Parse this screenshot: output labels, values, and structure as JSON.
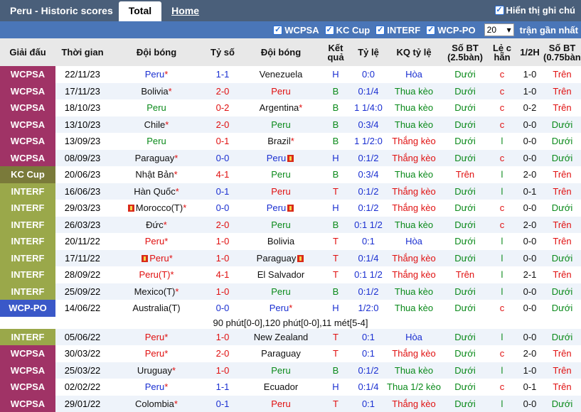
{
  "header": {
    "title": "Peru - Historic scores",
    "tab_total": "Total",
    "tab_home": "Home",
    "show_handicap_label": "Hiển thị ghi chú"
  },
  "filters": {
    "items": [
      "WCPSA",
      "KC Cup",
      "INTERF",
      "WCP-PO"
    ],
    "count_value": "20",
    "count_suffix": "trận gần nhất"
  },
  "columns": [
    "Giải đấu",
    "Thời gian",
    "Đội bóng",
    "Tỷ số",
    "Đội bóng",
    "Kết quả",
    "Tỷ lệ",
    "KQ tỷ lệ",
    "Số BT (2.5bàn)",
    "Lẻ c hẵn",
    "1/2H",
    "Số BT (0.75bàn)"
  ],
  "colors": {
    "WCPSA": "#a03366",
    "KC Cup": "#7a7a3a",
    "INTERF": "#9aa84a",
    "WCP-PO": "#3a58c8"
  },
  "separator_note": "90 phút[0-0],120 phút[0-0],11 mét[5-4]",
  "rows": [
    {
      "league": "WCPSA",
      "date": "22/11/23",
      "home": "Peru",
      "home_star": true,
      "home_flag": false,
      "home_color": "blue",
      "score": "1-1",
      "score_color": "blue",
      "away": "Venezuela",
      "away_star": false,
      "away_flag": false,
      "away_color": "black",
      "result": "H",
      "odds": "0:0",
      "odds_result": "Hòa",
      "ou": "Dưới",
      "oe": "c",
      "ht": "1-0",
      "ou2": "Trên"
    },
    {
      "league": "WCPSA",
      "date": "17/11/23",
      "home": "Bolivia",
      "home_star": true,
      "home_flag": false,
      "home_color": "black",
      "score": "2-0",
      "score_color": "red",
      "away": "Peru",
      "away_star": false,
      "away_flag": false,
      "away_color": "red",
      "result": "B",
      "odds": "0:1/4",
      "odds_result": "Thua kèo",
      "ou": "Dưới",
      "oe": "c",
      "ht": "1-0",
      "ou2": "Trên"
    },
    {
      "league": "WCPSA",
      "date": "18/10/23",
      "home": "Peru",
      "home_star": false,
      "home_flag": false,
      "home_color": "green",
      "score": "0-2",
      "score_color": "red",
      "away": "Argentina",
      "away_star": true,
      "away_flag": false,
      "away_color": "black",
      "result": "B",
      "odds": "1 1/4:0",
      "odds_result": "Thua kèo",
      "ou": "Dưới",
      "oe": "c",
      "ht": "0-2",
      "ou2": "Trên"
    },
    {
      "league": "WCPSA",
      "date": "13/10/23",
      "home": "Chile",
      "home_star": true,
      "home_flag": false,
      "home_color": "black",
      "score": "2-0",
      "score_color": "red",
      "away": "Peru",
      "away_star": false,
      "away_flag": false,
      "away_color": "green",
      "result": "B",
      "odds": "0:3/4",
      "odds_result": "Thua kèo",
      "ou": "Dưới",
      "oe": "c",
      "ht": "0-0",
      "ou2": "Dưới"
    },
    {
      "league": "WCPSA",
      "date": "13/09/23",
      "home": "Peru",
      "home_star": false,
      "home_flag": false,
      "home_color": "green",
      "score": "0-1",
      "score_color": "red",
      "away": "Brazil",
      "away_star": true,
      "away_flag": false,
      "away_color": "black",
      "result": "B",
      "odds": "1 1/2:0",
      "odds_result": "Thắng kèo",
      "ou": "Dưới",
      "oe": "l",
      "ht": "0-0",
      "ou2": "Dưới"
    },
    {
      "league": "WCPSA",
      "date": "08/09/23",
      "home": "Paraguay",
      "home_star": true,
      "home_flag": false,
      "home_color": "black",
      "score": "0-0",
      "score_color": "blue",
      "away": "Peru",
      "away_star": false,
      "away_flag": true,
      "away_color": "blue",
      "result": "H",
      "odds": "0:1/2",
      "odds_result": "Thắng kèo",
      "ou": "Dưới",
      "oe": "c",
      "ht": "0-0",
      "ou2": "Dưới"
    },
    {
      "league": "KC Cup",
      "date": "20/06/23",
      "home": "Nhật Bản",
      "home_star": true,
      "home_flag": false,
      "home_color": "black",
      "score": "4-1",
      "score_color": "red",
      "away": "Peru",
      "away_star": false,
      "away_flag": false,
      "away_color": "green",
      "result": "B",
      "odds": "0:3/4",
      "odds_result": "Thua kèo",
      "ou": "Trên",
      "oe": "l",
      "ht": "2-0",
      "ou2": "Trên"
    },
    {
      "league": "INTERF",
      "date": "16/06/23",
      "home": "Hàn Quốc",
      "home_star": true,
      "home_flag": false,
      "home_color": "black",
      "score": "0-1",
      "score_color": "blue",
      "away": "Peru",
      "away_star": false,
      "away_flag": false,
      "away_color": "red",
      "result": "T",
      "odds": "0:1/2",
      "odds_result": "Thắng kèo",
      "ou": "Dưới",
      "oe": "l",
      "ht": "0-1",
      "ou2": "Trên"
    },
    {
      "league": "INTERF",
      "date": "29/03/23",
      "home": "Morocco(T)",
      "home_star": true,
      "home_flag": true,
      "home_color": "black",
      "score": "0-0",
      "score_color": "blue",
      "away": "Peru",
      "away_star": false,
      "away_flag": true,
      "away_color": "blue",
      "result": "H",
      "odds": "0:1/2",
      "odds_result": "Thắng kèo",
      "ou": "Dưới",
      "oe": "c",
      "ht": "0-0",
      "ou2": "Dưới"
    },
    {
      "league": "INTERF",
      "date": "26/03/23",
      "home": "Đức",
      "home_star": true,
      "home_flag": false,
      "home_color": "black",
      "score": "2-0",
      "score_color": "red",
      "away": "Peru",
      "away_star": false,
      "away_flag": false,
      "away_color": "green",
      "result": "B",
      "odds": "0:1 1/2",
      "odds_result": "Thua kèo",
      "ou": "Dưới",
      "oe": "c",
      "ht": "2-0",
      "ou2": "Trên"
    },
    {
      "league": "INTERF",
      "date": "20/11/22",
      "home": "Peru",
      "home_star": true,
      "home_flag": false,
      "home_color": "red",
      "score": "1-0",
      "score_color": "red",
      "away": "Bolivia",
      "away_star": false,
      "away_flag": false,
      "away_color": "black",
      "result": "T",
      "odds": "0:1",
      "odds_result": "Hòa",
      "ou": "Dưới",
      "oe": "l",
      "ht": "0-0",
      "ou2": "Trên"
    },
    {
      "league": "INTERF",
      "date": "17/11/22",
      "home": "Peru",
      "home_star": true,
      "home_flag": true,
      "home_color": "red",
      "score": "1-0",
      "score_color": "red",
      "away": "Paraguay",
      "away_star": false,
      "away_flag": true,
      "away_color": "black",
      "result": "T",
      "odds": "0:1/4",
      "odds_result": "Thắng kèo",
      "ou": "Dưới",
      "oe": "l",
      "ht": "0-0",
      "ou2": "Dưới"
    },
    {
      "league": "INTERF",
      "date": "28/09/22",
      "home": "Peru(T)",
      "home_star": true,
      "home_flag": false,
      "home_color": "red",
      "score": "4-1",
      "score_color": "red",
      "away": "El Salvador",
      "away_star": false,
      "away_flag": false,
      "away_color": "black",
      "result": "T",
      "odds": "0:1 1/2",
      "odds_result": "Thắng kèo",
      "ou": "Trên",
      "oe": "l",
      "ht": "2-1",
      "ou2": "Trên"
    },
    {
      "league": "INTERF",
      "date": "25/09/22",
      "home": "Mexico(T)",
      "home_star": true,
      "home_flag": false,
      "home_color": "black",
      "score": "1-0",
      "score_color": "red",
      "away": "Peru",
      "away_star": false,
      "away_flag": false,
      "away_color": "green",
      "result": "B",
      "odds": "0:1/2",
      "odds_result": "Thua kèo",
      "ou": "Dưới",
      "oe": "l",
      "ht": "0-0",
      "ou2": "Dưới"
    },
    {
      "league": "WCP-PO",
      "date": "14/06/22",
      "home": "Australia(T)",
      "home_star": false,
      "home_flag": false,
      "home_color": "black",
      "score": "0-0",
      "score_color": "blue",
      "away": "Peru",
      "away_star": true,
      "away_flag": false,
      "away_color": "blue",
      "result": "H",
      "odds": "1/2:0",
      "odds_result": "Thua kèo",
      "ou": "Dưới",
      "oe": "c",
      "ht": "0-0",
      "ou2": "Dưới"
    },
    {
      "separator": true
    },
    {
      "league": "INTERF",
      "date": "05/06/22",
      "home": "Peru",
      "home_star": true,
      "home_flag": false,
      "home_color": "red",
      "score": "1-0",
      "score_color": "red",
      "away": "New Zealand",
      "away_star": false,
      "away_flag": false,
      "away_color": "black",
      "result": "T",
      "odds": "0:1",
      "odds_result": "Hòa",
      "ou": "Dưới",
      "oe": "l",
      "ht": "0-0",
      "ou2": "Dưới"
    },
    {
      "league": "WCPSA",
      "date": "30/03/22",
      "home": "Peru",
      "home_star": true,
      "home_flag": false,
      "home_color": "red",
      "score": "2-0",
      "score_color": "red",
      "away": "Paraguay",
      "away_star": false,
      "away_flag": false,
      "away_color": "black",
      "result": "T",
      "odds": "0:1",
      "odds_result": "Thắng kèo",
      "ou": "Dưới",
      "oe": "c",
      "ht": "2-0",
      "ou2": "Trên"
    },
    {
      "league": "WCPSA",
      "date": "25/03/22",
      "home": "Uruguay",
      "home_star": true,
      "home_flag": false,
      "home_color": "black",
      "score": "1-0",
      "score_color": "red",
      "away": "Peru",
      "away_star": false,
      "away_flag": false,
      "away_color": "green",
      "result": "B",
      "odds": "0:1/2",
      "odds_result": "Thua kèo",
      "ou": "Dưới",
      "oe": "l",
      "ht": "1-0",
      "ou2": "Trên"
    },
    {
      "league": "WCPSA",
      "date": "02/02/22",
      "home": "Peru",
      "home_star": true,
      "home_flag": false,
      "home_color": "blue",
      "score": "1-1",
      "score_color": "blue",
      "away": "Ecuador",
      "away_star": false,
      "away_flag": false,
      "away_color": "black",
      "result": "H",
      "odds": "0:1/4",
      "odds_result": "Thua 1/2 kèo",
      "ou": "Dưới",
      "oe": "c",
      "ht": "0-1",
      "ou2": "Trên"
    },
    {
      "league": "WCPSA",
      "date": "29/01/22",
      "home": "Colombia",
      "home_star": true,
      "home_flag": false,
      "home_color": "black",
      "score": "0-1",
      "score_color": "blue",
      "away": "Peru",
      "away_star": false,
      "away_flag": false,
      "away_color": "red",
      "result": "T",
      "odds": "0:1",
      "odds_result": "Thắng kèo",
      "ou": "Dưới",
      "oe": "l",
      "ht": "0-0",
      "ou2": "Dưới"
    }
  ]
}
